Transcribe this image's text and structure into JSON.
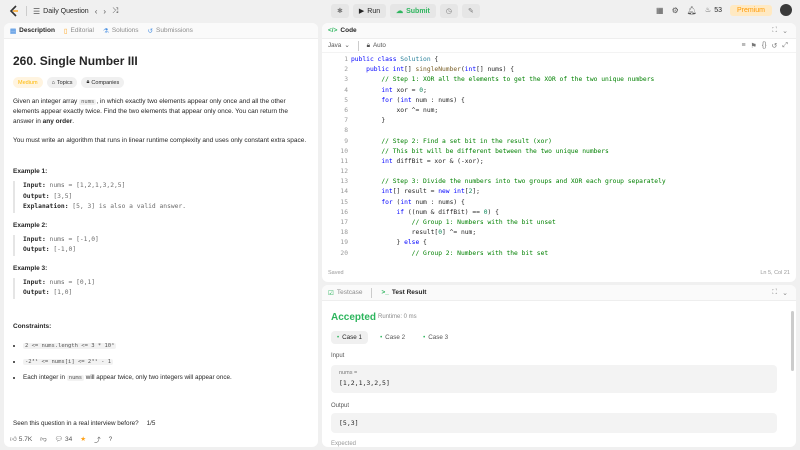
{
  "topbar": {
    "problem_list": "Daily Question",
    "run": "Run",
    "submit": "Submit",
    "streak": "53",
    "premium": "Premium"
  },
  "left": {
    "tabs": [
      "Description",
      "Editorial",
      "Solutions",
      "Submissions"
    ],
    "title": "260. Single Number III",
    "tags": [
      "Medium",
      "Topics",
      "Companies"
    ],
    "p1_a": "Given an integer array ",
    "p1_code": "nums",
    "p1_b": ", in which exactly two elements appear only once and all the other elements appear exactly twice. Find the two elements that appear only once. You can return the answer in ",
    "p1_bold": "any order",
    "p1_c": ".",
    "p2": "You must write an algorithm that runs in linear runtime complexity and uses only constant extra space.",
    "examples": [
      {
        "heading": "Example 1:",
        "input_label": "Input:",
        "input": " nums = [1,2,1,3,2,5]",
        "output_label": "Output:",
        "output": " [3,5]",
        "explanation_label": "Explanation:",
        "explanation": "  [5, 3] is also a valid answer."
      },
      {
        "heading": "Example 2:",
        "input_label": "Input:",
        "input": " nums = [-1,0]",
        "output_label": "Output:",
        "output": " [-1,0]"
      },
      {
        "heading": "Example 3:",
        "input_label": "Input:",
        "input": " nums = [0,1]",
        "output_label": "Output:",
        "output": " [1,0]"
      }
    ],
    "constraints_heading": "Constraints:",
    "constraints": [
      "2 <= nums.length <= 3 * 10⁴",
      "-2³¹ <= nums[i] <= 2³¹ - 1"
    ],
    "constraint3_a": "Each integer in ",
    "constraint3_code": "nums",
    "constraint3_b": " will appear twice, only two integers will appear once.",
    "interview_q": "Seen this question in a real interview before?",
    "interview_count": "1/5",
    "likes": "5.7K",
    "comments": "34"
  },
  "code": {
    "tab": "Code",
    "language": "Java",
    "mode": "Auto",
    "status": "Saved",
    "position": "Ln 5, Col 21",
    "line_numbers": [
      "1",
      "2",
      "3",
      "4",
      "5",
      "6",
      "7",
      "8",
      "9",
      "10",
      "11",
      "12",
      "13",
      "14",
      "15",
      "16",
      "17",
      "18",
      "19",
      "20"
    ]
  },
  "result": {
    "tabs": [
      "Testcase",
      "Test Result"
    ],
    "status": "Accepted",
    "runtime": "Runtime: 0 ms",
    "cases": [
      "Case 1",
      "Case 2",
      "Case 3"
    ],
    "input_label": "Input",
    "input_var": "nums =",
    "input_value": "[1,2,1,3,2,5]",
    "output_label": "Output",
    "output_value": "[5,3]",
    "expected_label": "Expected"
  },
  "colors": {
    "accepted": "#2db55d",
    "premium": "#ff9900",
    "medium": "#ffb800"
  }
}
